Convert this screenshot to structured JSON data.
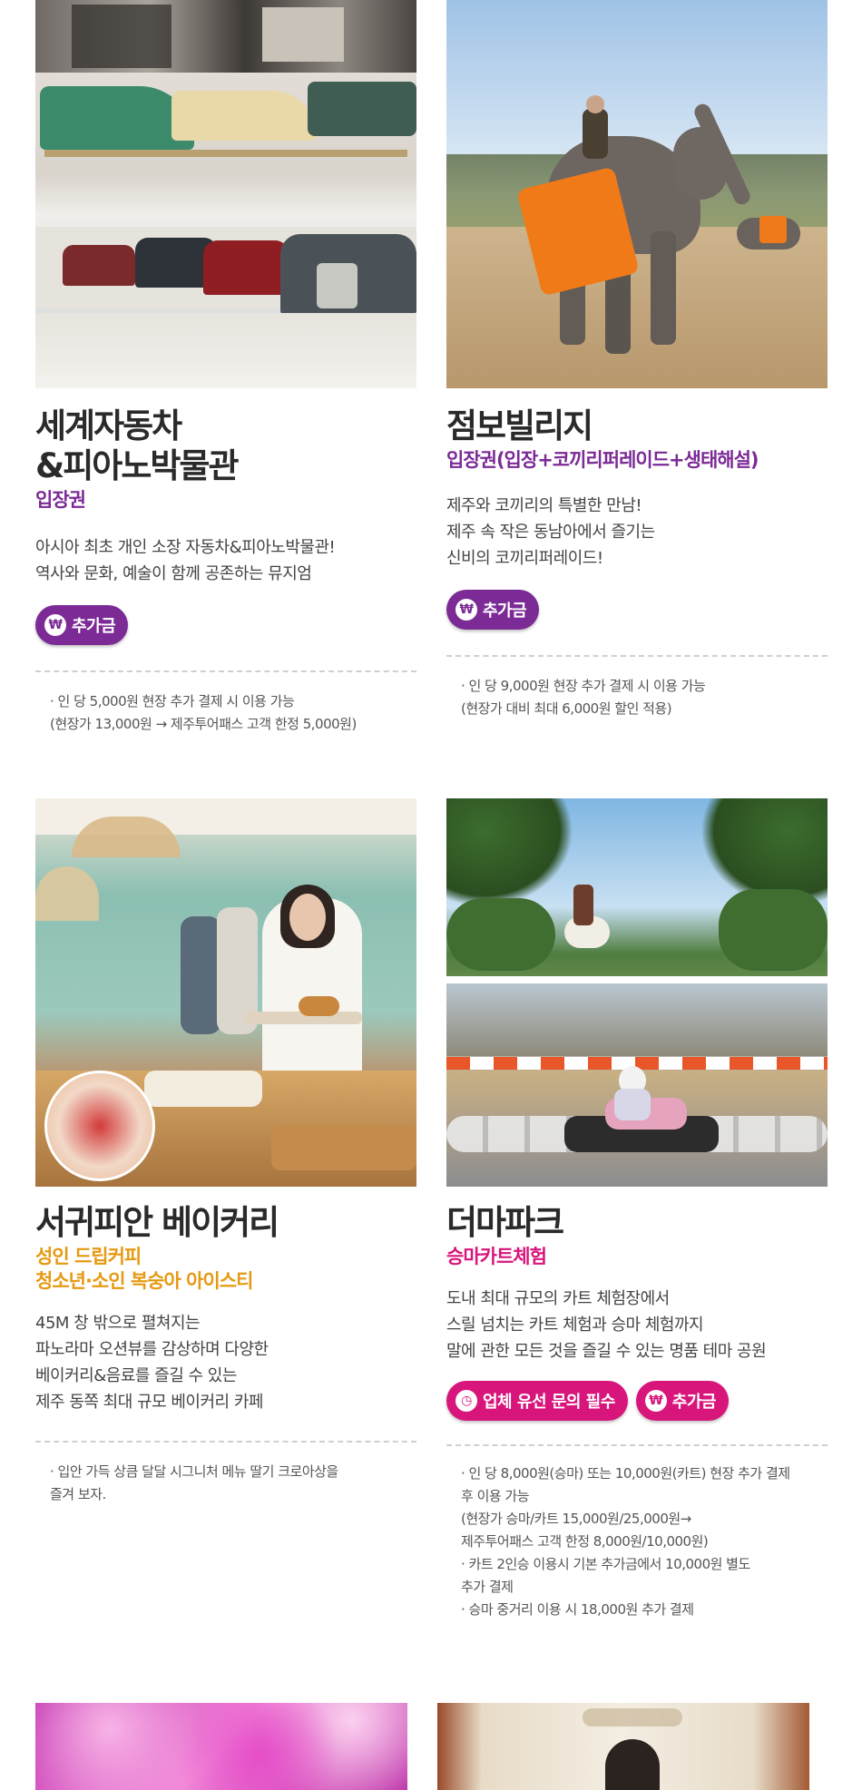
{
  "cards": [
    {
      "title": "세계자동차\n&피아노박물관",
      "subtitle": "입장권",
      "description": "아시아 최초 개인 소장 자동차&피아노박물관!\n역사와 문화, 예술이 함께 공존하는 뮤지엄",
      "buttons": [
        {
          "label": "추가금",
          "icon": "won-coin-icon"
        }
      ],
      "notes": [
        "· 인 당 5,000원 현장 추가 결제 시 이용 가능\n  (현장가 13,000원 → 제주투어패스 고객 한정 5,000원)"
      ]
    },
    {
      "title": "점보빌리지",
      "subtitle": "입장권(입장+코끼리퍼레이드+생태해설)",
      "description": "제주와 코끼리의 특별한 만남!\n제주 속 작은 동남아에서 즐기는\n신비의 코끼리퍼레이드!",
      "buttons": [
        {
          "label": "추가금",
          "icon": "won-coin-icon"
        }
      ],
      "notes": [
        "· 인 당 9,000원 현장 추가 결제 시 이용 가능\n  (현장가 대비 최대 6,000원 할인 적용)"
      ]
    },
    {
      "title": "서귀피안 베이커리",
      "subtitle": "성인 드립커피\n청소년·소인 복숭아 아이스티",
      "description": "45M 창 밖으로 펼쳐지는\n파노라마 오션뷰를 감상하며 다양한\n베이커리&음료를 즐길 수 있는\n제주 동쪽 최대 규모 베이커리 카페",
      "notes": [
        "· 입안 가득 상큼 달달 시그니처 메뉴 딸기 크로아상을\n  즐겨 보자."
      ]
    },
    {
      "title": "더마파크",
      "subtitle": "승마카트체험",
      "description": "도내 최대 규모의 카트 체험장에서\n스릴 넘치는 카트 체험과 승마 체험까지\n말에 관한 모든 것을 즐길 수 있는 명품 테마 공원",
      "buttons": [
        {
          "label": "업체 유선 문의 필수",
          "icon": "clock-icon"
        },
        {
          "label": "추가금",
          "icon": "won-coin-icon"
        }
      ],
      "notes": [
        "· 인 당  8,000원(승마) 또는 10,000원(카트) 현장 추가 결제\n   후 이용 가능\n  (현장가 승마/카트 15,000원/25,000원→\n  제주투어패스 고객 한정 8,000원/10,000원)",
        "· 카트 2인승 이용시 기본 추가금에서 10,000원 별도\n   추가 결제",
        "· 승마 중거리 이용 시 18,000원 추가 결제"
      ]
    }
  ],
  "colors": {
    "purple": "#7b2a96",
    "orange": "#e59a13",
    "magenta": "#d8157b"
  }
}
